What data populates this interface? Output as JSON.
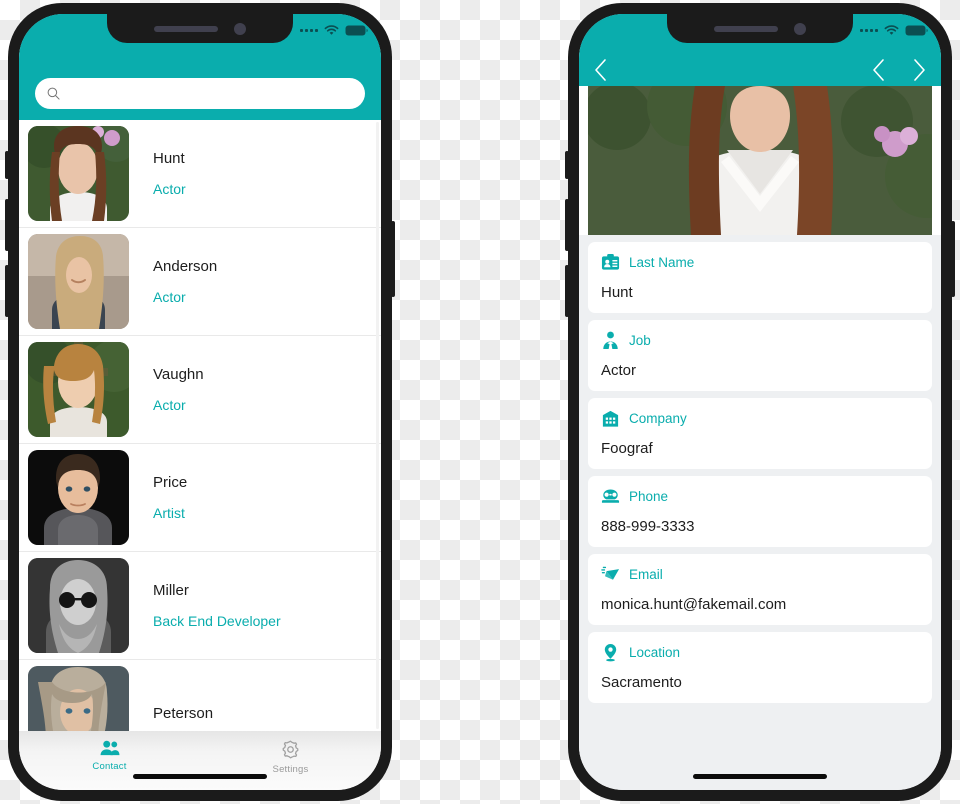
{
  "theme": {
    "accent": "#0aadad",
    "frame": "#1b1b1b",
    "card_bg": "#ffffff",
    "detail_bg": "#eef0f2",
    "text": "#1d1d1d"
  },
  "left_phone": {
    "status_bar": {
      "signal_icon": "signal-dots-icon",
      "wifi_icon": "wifi-icon",
      "battery_icon": "battery-icon"
    },
    "search": {
      "value": "",
      "placeholder": "",
      "icon": "search-icon"
    },
    "contacts": [
      {
        "name": "Hunt",
        "job": "Actor",
        "avatar": "avatar-hunt"
      },
      {
        "name": "Anderson",
        "job": "Actor",
        "avatar": "avatar-anderson"
      },
      {
        "name": "Vaughn",
        "job": "Actor",
        "avatar": "avatar-vaughn"
      },
      {
        "name": "Price",
        "job": "Artist",
        "avatar": "avatar-price"
      },
      {
        "name": "Miller",
        "job": "Back End Developer",
        "avatar": "avatar-miller"
      },
      {
        "name": "Peterson",
        "job": "",
        "avatar": "avatar-peterson"
      }
    ],
    "tabs": [
      {
        "label": "Contact",
        "icon": "contacts-icon",
        "active": true
      },
      {
        "label": "Settings",
        "icon": "gear-icon",
        "active": false
      }
    ]
  },
  "right_phone": {
    "status_bar": {
      "signal_icon": "signal-dots-icon",
      "wifi_icon": "wifi-icon",
      "battery_icon": "battery-icon"
    },
    "nav": {
      "back_icon": "chevron-left-icon",
      "prev_icon": "chevron-left-icon",
      "next_icon": "chevron-right-icon"
    },
    "hero": {
      "image": "contact-photo-hunt"
    },
    "fields": [
      {
        "label": "Last Name",
        "value": "Hunt",
        "icon": "id-badge-icon"
      },
      {
        "label": "Job",
        "value": "Actor",
        "icon": "person-tie-icon"
      },
      {
        "label": "Company",
        "value": "Foograf",
        "icon": "building-icon"
      },
      {
        "label": "Phone",
        "value": "888-999-3333",
        "icon": "phone-icon"
      },
      {
        "label": "Email",
        "value": "monica.hunt@fakemail.com",
        "icon": "envelope-icon"
      },
      {
        "label": "Location",
        "value": "Sacramento",
        "icon": "map-pin-icon"
      }
    ]
  }
}
